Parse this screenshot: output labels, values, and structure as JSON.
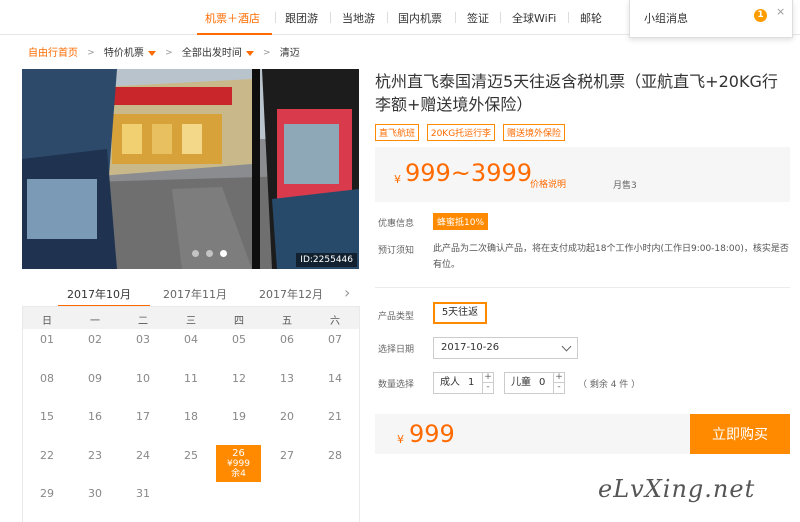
{
  "nav": {
    "items": [
      "机票＋酒店",
      "跟团游",
      "当地游",
      "国内机票",
      "签证",
      "全球WiFi",
      "邮轮"
    ],
    "message_title": "小组消息",
    "message_count": "1",
    "close_label": "×"
  },
  "breadcrumb": [
    "自由行首页",
    "特价机票",
    "全部出发时间",
    "清迈"
  ],
  "photo": {
    "id_label": "ID:2255446"
  },
  "product": {
    "title": "杭州直飞泰国清迈5天往返含税机票（亚航直飞+20KG行李额+赠送境外保险）",
    "tags": [
      "直飞航班",
      "20KG托运行李",
      "赠送境外保险"
    ],
    "currency": "¥",
    "price_range": "999~3999",
    "price_explain": "价格说明",
    "monthly_sales": "月售3",
    "promo_label": "优惠信息",
    "promo_tag": "蜂蜜抵10%",
    "notice_label": "预订须知",
    "notice_text": "此产品为二次确认产品，将在支付成功起18个工作小时内(工作日9:00-18:00)，核实是否有位。",
    "type_label": "产品类型",
    "type_value": "5天往返",
    "date_label": "选择日期",
    "date_value": "2017-10-26",
    "qty_label": "数量选择",
    "adult_label": "成人",
    "adult_value": "1",
    "child_label": "儿童",
    "child_value": "0",
    "plus": "+",
    "minus": "-",
    "remaining": "（ 剩余 4 件 ）",
    "total_price": "999",
    "buy_label": "立即购买"
  },
  "calendar": {
    "months": [
      "2017年10月",
      "2017年11月",
      "2017年12月"
    ],
    "active_month": 0,
    "next_icon": "chevron-right-icon",
    "weekdays": [
      "日",
      "一",
      "二",
      "三",
      "四",
      "五",
      "六"
    ],
    "days": [
      "01",
      "02",
      "03",
      "04",
      "05",
      "06",
      "07",
      "08",
      "09",
      "10",
      "11",
      "12",
      "13",
      "14",
      "15",
      "16",
      "17",
      "18",
      "19",
      "20",
      "21",
      "22",
      "23",
      "24",
      "25",
      "26",
      "27",
      "28",
      "29",
      "30",
      "31"
    ],
    "first_weekday": 0,
    "selected": {
      "day": "26",
      "price": "¥999",
      "stock": "余4"
    }
  },
  "watermark": "eLvXing.net",
  "colors": {
    "accent": "#ff6b00",
    "accent_fill": "#ff8a00"
  }
}
